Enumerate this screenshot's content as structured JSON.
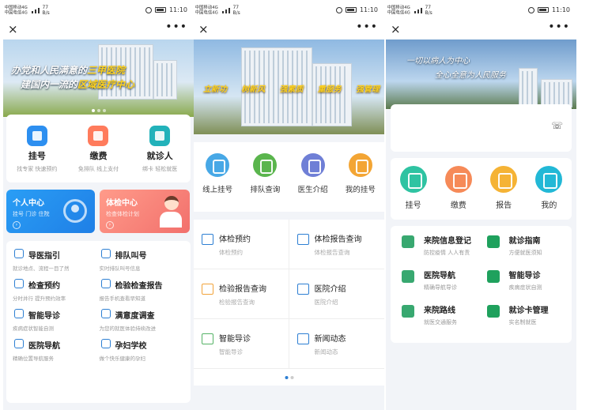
{
  "status": {
    "carrier1": "中国移动4G",
    "carrier2": "中国电信4G",
    "speed_value": "77",
    "speed_unit": "B/s",
    "time": "11:10"
  },
  "nav": {
    "close_icon": "×",
    "more_icon": "•••"
  },
  "screen1": {
    "banner": {
      "line1_pre": "办党和人民满意的",
      "line1_hl": "三甲医院",
      "line2_pre": "建国内一流的",
      "line2_hl": "区域医疗中心"
    },
    "top_items": [
      {
        "title": "挂号",
        "sub": "找专家 快速预约",
        "color": "#2d8ff0"
      },
      {
        "title": "缴费",
        "sub": "免排队 线上支付",
        "color": "#ff7b5c"
      },
      {
        "title": "就诊人",
        "sub": "绑卡 轻松就医",
        "color": "#22b2ba"
      }
    ],
    "promo_left": {
      "title": "个人中心",
      "sub": "挂号 门诊 住院"
    },
    "promo_right": {
      "title": "体检中心",
      "sub": "检查体检计划"
    },
    "list": [
      {
        "title": "导医指引",
        "sub": "就诊地点、流程一目了然"
      },
      {
        "title": "排队叫号",
        "sub": "实时排队叫号信息"
      },
      {
        "title": "检查预约",
        "sub": "分时并行 提升预约效率"
      },
      {
        "title": "检验检查报告",
        "sub": "报告手机查看早知道"
      },
      {
        "title": "智能导诊",
        "sub": "疾病症状智能自测"
      },
      {
        "title": "满意度调查",
        "sub": "为您的就医体验持续改进"
      },
      {
        "title": "医院导航",
        "sub": "精确位置导航服务"
      },
      {
        "title": "孕妇学校",
        "sub": "做个快乐健康的孕妇"
      }
    ]
  },
  "screen2": {
    "banner_slogans": [
      "立新功",
      "树新风",
      "强素质",
      "重服务",
      "强管理"
    ],
    "icons": [
      {
        "title": "线上挂号",
        "color": "#47a8e6"
      },
      {
        "title": "排队查询",
        "color": "#5ab54d"
      },
      {
        "title": "医生介绍",
        "color": "#6f7fd6"
      },
      {
        "title": "我的挂号",
        "color": "#f3a534"
      }
    ],
    "grid": [
      {
        "title": "体检预约",
        "sub": "体检预约",
        "tone": ""
      },
      {
        "title": "体检报告查询",
        "sub": "体检报告查询",
        "tone": ""
      },
      {
        "title": "检验报告查询",
        "sub": "检验报告查询",
        "tone": "orange"
      },
      {
        "title": "医院介绍",
        "sub": "医院介绍",
        "tone": ""
      },
      {
        "title": "智能导诊",
        "sub": "智能导诊",
        "tone": "green"
      },
      {
        "title": "新闻动态",
        "sub": "新闻动态",
        "tone": ""
      }
    ]
  },
  "screen3": {
    "banner": {
      "line1": "一切以病人为中心",
      "line2": "全心全意为人民服务"
    },
    "phone_icon": "☏",
    "icons": [
      {
        "title": "挂号",
        "color": "#2fc3a2"
      },
      {
        "title": "缴费",
        "color": "#f68a58"
      },
      {
        "title": "报告",
        "color": "#f5b335"
      },
      {
        "title": "我的",
        "color": "#22b8d6"
      }
    ],
    "list": [
      {
        "title": "来院信息登记",
        "sub": "防控疫情 人人有责"
      },
      {
        "title": "就诊指南",
        "sub": "方便就医须知"
      },
      {
        "title": "医院导航",
        "sub": "精确导航导诊"
      },
      {
        "title": "智能导诊",
        "sub": "疾病症状自测"
      },
      {
        "title": "来院路线",
        "sub": "就医交通服务"
      },
      {
        "title": "就诊卡管理",
        "sub": "实名制就医"
      }
    ]
  }
}
